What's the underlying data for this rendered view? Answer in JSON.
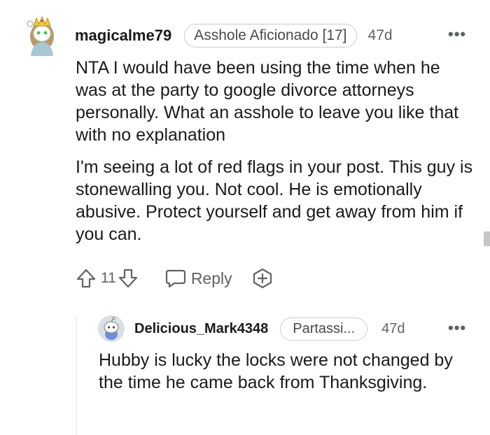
{
  "comment": {
    "username": "magicalme79",
    "flair": "Asshole Aficionado [17]",
    "age": "47d",
    "more_label": "•••",
    "body": [
      "NTA I would have been using the time when he was at the party to google divorce attorneys personally. What an asshole to leave you like that with no explanation",
      "I'm seeing a lot of red flags in your post. This guy is stonewalling you. Not cool. He is emotionally abusive. Protect yourself and get away from him if you can."
    ],
    "score": "11",
    "reply_label": "Reply",
    "icons": {
      "avatar": "snoo-avatar-crown",
      "upvote": "upvote-arrow-icon",
      "downvote": "downvote-arrow-icon",
      "reply": "speech-bubble-icon",
      "award": "add-award-icon",
      "more": "more-options-icon"
    }
  },
  "reply": {
    "username": "Delicious_Mark4348",
    "flair": "Partassi...",
    "age": "47d",
    "more_label": "•••",
    "body": [
      "Hubby is lucky the locks were not changed by the time he came back from Thanksgiving."
    ]
  },
  "colors": {
    "text": "#1a1a1b",
    "muted": "#5f6366",
    "border": "#c9ccd0",
    "thread_line": "#e4e6e8"
  }
}
